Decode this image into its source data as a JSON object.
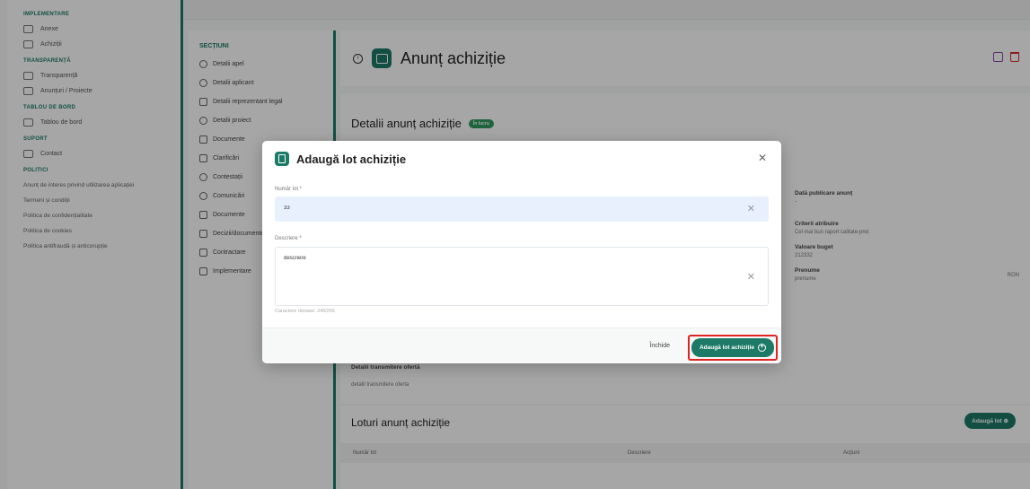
{
  "colors": {
    "accent": "#1c7a66",
    "highlight": "#e02424",
    "status_badge": "#2e9a5f"
  },
  "sidebar": {
    "groups": [
      {
        "heading": "IMPLEMENTARE",
        "items": [
          {
            "label": "Anexe",
            "icon": "folder-icon"
          },
          {
            "label": "Achiziții",
            "icon": "document-icon"
          }
        ]
      },
      {
        "heading": "TRANSPARENȚĂ",
        "items": [
          {
            "label": "Transparență",
            "icon": "grid-icon"
          },
          {
            "label": "Anunțuri / Proiecte",
            "icon": "globe-icon"
          }
        ]
      },
      {
        "heading": "TABLOU DE BORD",
        "items": [
          {
            "label": "Tablou de bord",
            "icon": "dashboard-icon"
          }
        ]
      },
      {
        "heading": "SUPORT",
        "items": [
          {
            "label": "Contact",
            "icon": "mail-icon"
          }
        ]
      },
      {
        "heading": "POLITICI",
        "items": []
      }
    ],
    "links": [
      "Anunț de interes privind utilizarea aplicației",
      "Termeni și condiții",
      "Politica de confidențialitate",
      "Politica de cookies",
      "Politica antifraudă și anticorupție"
    ]
  },
  "sections": {
    "title": "SECȚIUNI",
    "items": [
      "Detalii apel",
      "Detalii aplicant",
      "Detalii reprezentant legal",
      "Detalii proiect",
      "Documente",
      "Clarificări",
      "Contestații",
      "Comunicări",
      "Documente",
      "Decizii/documente",
      "Contractare",
      "Implementare"
    ]
  },
  "header": {
    "title": "Anunț achiziție"
  },
  "details": {
    "title": "Detalii anunț achiziție",
    "status": "În lucru",
    "fields": [
      {
        "label": "Dată publicare anunț",
        "value": "-"
      },
      {
        "label": "Criterii atribuire",
        "value": "Cel mai bun raport calitate-preț"
      },
      {
        "label": "Valoare buget",
        "value": "212332"
      },
      {
        "label": "Prenume",
        "value": "prenume"
      }
    ],
    "currency": "RON",
    "transmission_label": "Detalii transmitere ofertă",
    "transmission_value": "detalii transmitere oferta"
  },
  "lots": {
    "title": "Loturi anunț achiziție",
    "add_label": "Adaugă lot",
    "columns": [
      "Număr lot",
      "Descriere",
      "Acțiuni"
    ]
  },
  "modal": {
    "title": "Adaugă lot achiziție",
    "lot_number_label": "Număr lot *",
    "lot_number_value": "33",
    "description_label": "Descriere *",
    "description_value": "descriere",
    "char_hint": "Caractere rămase: 246/255",
    "close_label": "Închide",
    "submit_label": "Adaugă lot achiziție"
  }
}
